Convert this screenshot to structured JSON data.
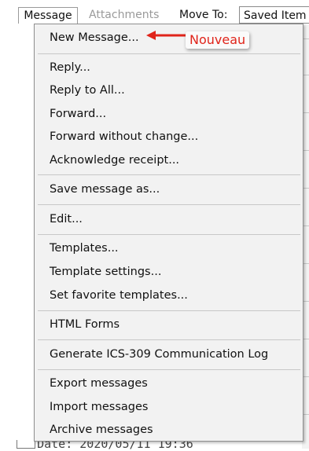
{
  "menubar": {
    "message_tab": "Message",
    "attachments_tab": "Attachments",
    "move_to_label": "Move To:",
    "move_to_value": "Saved Item"
  },
  "menu": {
    "groups": [
      [
        "New Message..."
      ],
      [
        "Reply...",
        "Reply to All...",
        "Forward...",
        "Forward without change...",
        "Acknowledge receipt..."
      ],
      [
        "Save message as..."
      ],
      [
        "Edit..."
      ],
      [
        "Templates...",
        "Template settings...",
        "Set favorite templates..."
      ],
      [
        "HTML Forms"
      ],
      [
        "Generate ICS-309 Communication Log"
      ],
      [
        "Export messages",
        "Import messages",
        "Archive messages"
      ]
    ]
  },
  "background": {
    "date_line": "Date: 2020/05/11 19:36"
  },
  "annotation": {
    "label": "Nouveau",
    "color": "#e0241a"
  }
}
